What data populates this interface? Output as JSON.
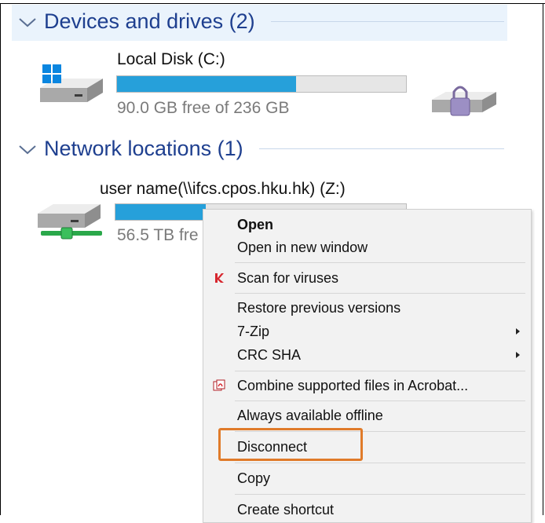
{
  "sections": {
    "devices": {
      "title": "Devices and drives (2)"
    },
    "network": {
      "title": "Network locations (1)"
    }
  },
  "drives": {
    "local": {
      "name": "Local Disk (C:)",
      "free_text": "90.0 GB free of 236 GB",
      "used_fraction": 0.62
    },
    "network": {
      "name": "user name(\\\\ifcs.cpos.hku.hk) (Z:)",
      "free_text": "56.5 TB fre",
      "used_fraction": 0.31
    }
  },
  "context_menu": {
    "items": [
      {
        "label": "Open",
        "bold": true
      },
      {
        "label": "Open in new window"
      },
      {
        "label": "Scan for viruses",
        "icon": "antivirus-icon"
      },
      {
        "label": "Restore previous versions"
      },
      {
        "label": "7-Zip",
        "submenu": true
      },
      {
        "label": "CRC SHA",
        "submenu": true
      },
      {
        "label": "Combine supported files in Acrobat...",
        "icon": "acrobat-icon"
      },
      {
        "label": "Always available offline"
      },
      {
        "label": "Disconnect",
        "highlighted": true
      },
      {
        "label": "Copy"
      },
      {
        "label": "Create shortcut"
      }
    ]
  },
  "colors": {
    "accent": "#26a0da",
    "header_text": "#1e3f8f",
    "highlight": "#e07b2a"
  }
}
